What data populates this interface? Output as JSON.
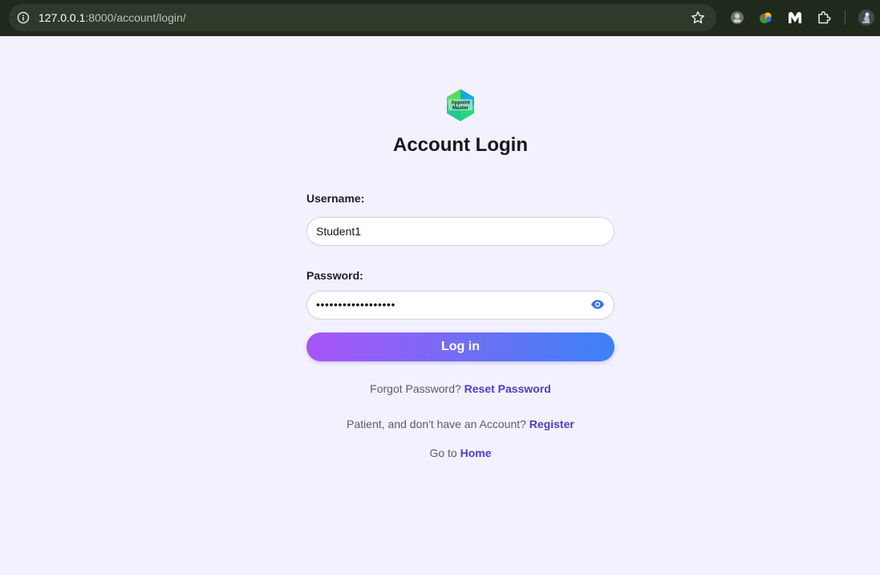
{
  "browser": {
    "url_host": "127.0.0.1",
    "url_path": ":8000/account/login/"
  },
  "page": {
    "title": "Account Login",
    "logo_text_line1": "Appoint",
    "logo_text_line2": "Master"
  },
  "form": {
    "username_label": "Username:",
    "username_value": "Student1",
    "password_label": "Password:",
    "password_masked": "••••••••••••••••••",
    "login_button": "Log in"
  },
  "links": {
    "forgot_prefix": "Forgot Password?",
    "reset_link": "Reset Password",
    "register_prefix": "Patient, and don't have an Account?",
    "register_link": "Register",
    "home_prefix": "Go to",
    "home_link": "Home"
  },
  "colors": {
    "page_background": "#f3f1fd",
    "link": "#4b3fc4",
    "button_gradient_start": "#a855f7",
    "button_gradient_end": "#3b82f6"
  }
}
